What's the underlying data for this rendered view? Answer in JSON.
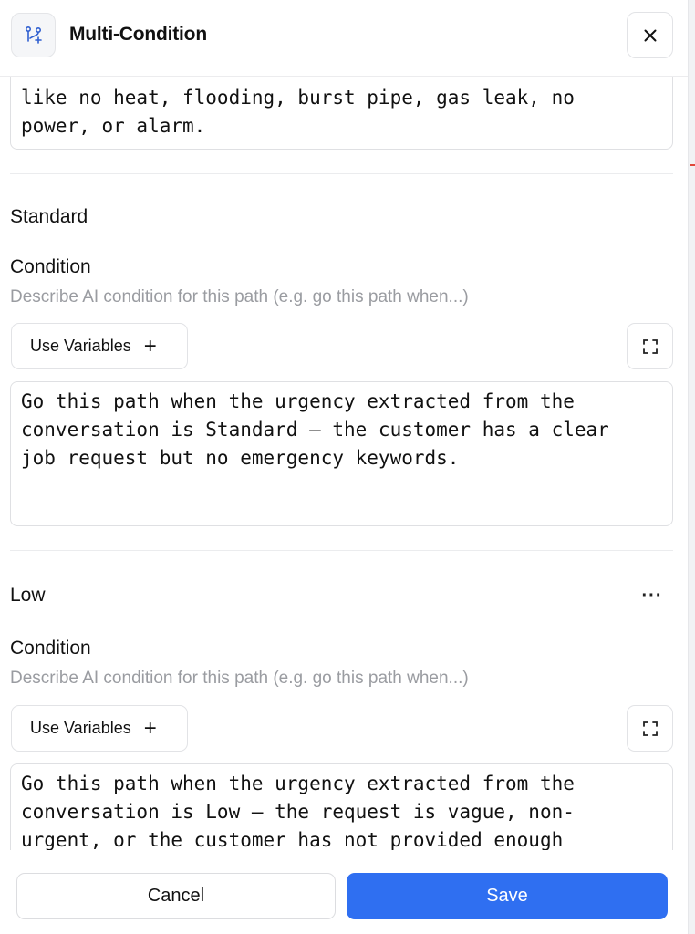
{
  "header": {
    "title": "Multi-Condition",
    "icon": "branch-plus-icon",
    "close_icon": "close-icon"
  },
  "top_condition_text_tail": "like no heat, flooding, burst pipe, gas leak, no\npower, or alarm.",
  "paths": [
    {
      "name": "Standard",
      "condition_label": "Condition",
      "condition_hint": "Describe AI condition for this path (e.g. go this path when...)",
      "use_variables_label": "Use Variables",
      "condition_text": "Go this path when the urgency extracted from the\nconversation is Standard — the customer has a clear\njob request but no emergency keywords."
    },
    {
      "name": "Low",
      "more_icon": "more-horizontal-icon",
      "condition_label": "Condition",
      "condition_hint": "Describe AI condition for this path (e.g. go this path when...)",
      "use_variables_label": "Use Variables",
      "condition_text": "Go this path when the urgency extracted from the\nconversation is Low — the request is vague, non-\nurgent, or the customer has not provided enough"
    }
  ],
  "footer": {
    "cancel_label": "Cancel",
    "save_label": "Save"
  },
  "colors": {
    "primary": "#2f6ff1",
    "hint_text": "#9a9ca1",
    "border": "#dfe0e3"
  }
}
